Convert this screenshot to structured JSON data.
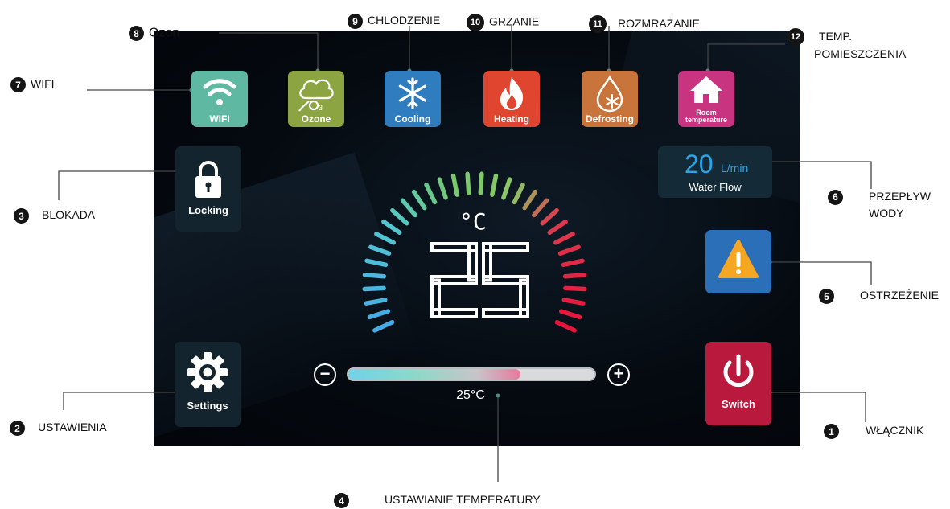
{
  "tiles": {
    "wifi": {
      "label": "WIFI",
      "color": "#5fb9a2"
    },
    "ozone": {
      "label": "Ozone",
      "color": "#8ca542"
    },
    "cooling": {
      "label": "Cooling",
      "color": "#2f7cbf"
    },
    "heating": {
      "label": "Heating",
      "color": "#e0452f"
    },
    "defrosting": {
      "label": "Defrosting",
      "color": "#c9743a"
    },
    "room": {
      "label_line1": "Room",
      "label_line2": "temperature",
      "color": "#c8347f"
    },
    "locking": {
      "label": "Locking",
      "color": "#14242e"
    },
    "settings": {
      "label": "Settings",
      "color": "#14242e"
    },
    "warning": {
      "color": "#2a6fb8",
      "symbol_color": "#f5a623"
    },
    "switch": {
      "label": "Switch",
      "color": "#b8193c"
    }
  },
  "water_flow": {
    "value": "20",
    "unit": "L/min",
    "caption": "Water Flow"
  },
  "display": {
    "unit": "°C",
    "temperature": "25"
  },
  "setpoint": {
    "value": "25°C",
    "minus": "−",
    "plus": "+",
    "fill_fraction": 0.7
  },
  "callouts": [
    {
      "num": "1",
      "text": "WŁĄCZNIK"
    },
    {
      "num": "2",
      "text": "USTAWIENIA"
    },
    {
      "num": "3",
      "text": "BLOKADA"
    },
    {
      "num": "4",
      "text": "USTAWIANIE TEMPERATURY"
    },
    {
      "num": "5",
      "text": "OSTRZEŻENIE"
    },
    {
      "num": "6",
      "text_line1": "PRZEPŁYW",
      "text_line2": "WODY"
    },
    {
      "num": "7",
      "text": "WIFI"
    },
    {
      "num": "8",
      "text": "Ozon"
    },
    {
      "num": "9",
      "text": "CHLODZENIE"
    },
    {
      "num": "10",
      "text": "GRZANIE"
    },
    {
      "num": "11",
      "text": "ROZMRAŻANIE"
    },
    {
      "num": "12",
      "text_line1": "TEMP.",
      "text_line2": "POMIESZCZENIA"
    }
  ]
}
